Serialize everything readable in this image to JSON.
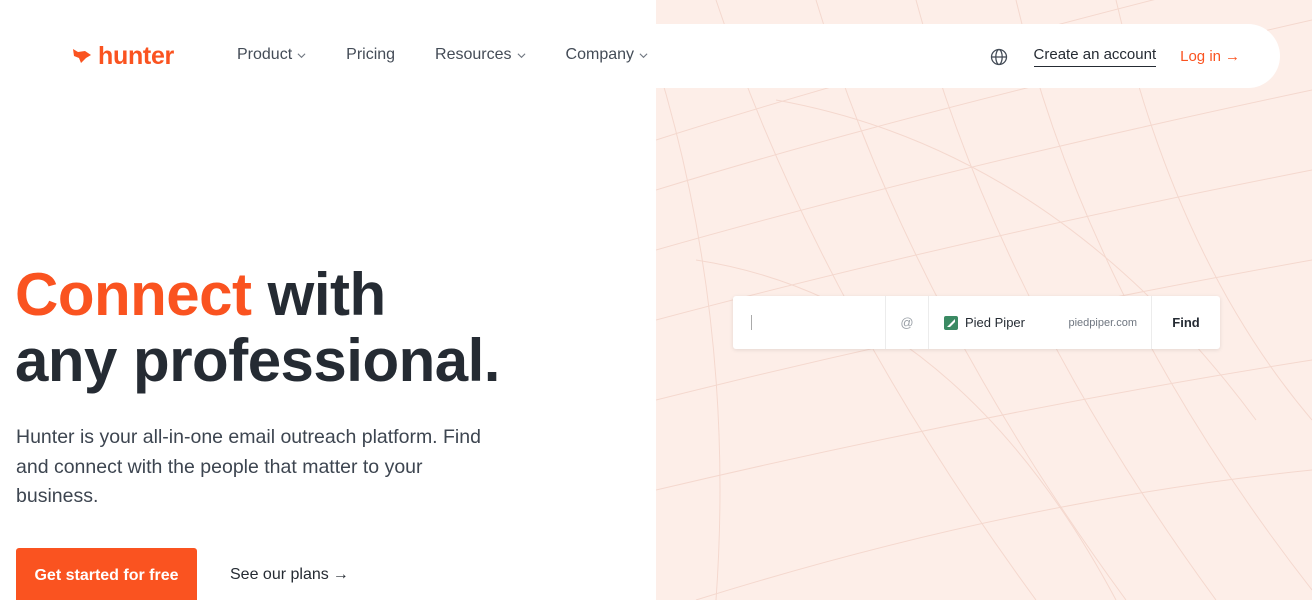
{
  "brand": {
    "name": "hunter",
    "accent_color": "#fa5320"
  },
  "nav": {
    "items": [
      {
        "label": "Product",
        "has_dropdown": true
      },
      {
        "label": "Pricing",
        "has_dropdown": false
      },
      {
        "label": "Resources",
        "has_dropdown": true
      },
      {
        "label": "Company",
        "has_dropdown": true
      }
    ],
    "language_icon": "globe-icon",
    "create_account": "Create an account",
    "login": "Log in",
    "login_arrow": "→"
  },
  "hero": {
    "headline_accent": "Connect",
    "headline_rest": " with",
    "headline_line2": "any professional.",
    "description": "Hunter is your all-in-one email outreach platform. Find and connect with the people that matter to your business.",
    "cta_primary": "Get started for free",
    "cta_secondary": "See our plans",
    "cta_secondary_arrow": "→"
  },
  "finder": {
    "name_value": "",
    "at_symbol": "@",
    "company_name": "Pied Piper",
    "company_logo_color": "#3a8a63",
    "domain": "piedpiper.com",
    "button": "Find"
  },
  "colors": {
    "panel_bg": "#fdeee8",
    "text_dark": "#252b33"
  }
}
